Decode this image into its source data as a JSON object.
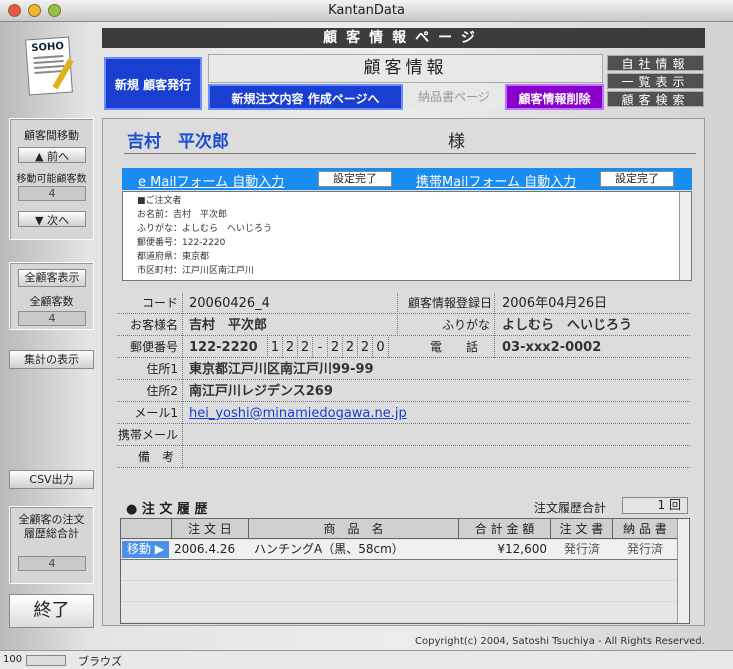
{
  "window": {
    "title": "KantanData"
  },
  "header": {
    "page_title": "顧客情報ページ"
  },
  "nav": {
    "new_customer": "新規 顧客発行",
    "new_order_page": "新規注文内容 作成ページへ",
    "delivery_page": "納品書ページ",
    "delete_customer": "顧客情報削除",
    "company_info": "自社情報",
    "list_view": "一覧表示",
    "customer_search": "顧客検索"
  },
  "section": {
    "title": "顧客情報"
  },
  "left": {
    "logo_text": "SOHO",
    "move_label": "顧客間移動",
    "prev": "▲ 前へ",
    "movable_label": "移動可能顧客数",
    "movable_count": "4",
    "next": "▼ 次へ",
    "show_all": "全顧客表示",
    "total_label": "全顧客数",
    "total_count": "4",
    "summary": "集計の表示",
    "csv": "CSV出力",
    "total_orders_label": "全顧客の注文履歴総合計",
    "total_orders": "4",
    "quit": "終了"
  },
  "customer": {
    "name": "吉村　平次郎",
    "honorific": "様"
  },
  "mail": {
    "email_form": "e Mailフォーム 自動入力",
    "email_done": "設定完了",
    "mobile_form": "携帯Mailフォーム 自動入力",
    "mobile_done": "設定完了",
    "preview_lines": [
      "■ご注文者",
      "お名前：吉村　平次郎",
      "ふりがな：よしむら　へいじろう",
      "郵便番号：122-2220",
      "都道府県：東京都",
      "市区町村：江戸川区南江戸川"
    ]
  },
  "fields": {
    "code_label": "コード",
    "code": "20060426_4",
    "reg_label": "顧客情報登録日",
    "reg_date": "2006年04月26日",
    "name_label": "お客様名",
    "name": "吉村　平次郎",
    "kana_label": "ふりがな",
    "kana": "よしむら　へいじろう",
    "zip_label": "郵便番号",
    "zip": "122-2220",
    "zip_digits": [
      "1",
      "2",
      "2",
      "-",
      "2",
      "2",
      "2",
      "0"
    ],
    "tel_label": "電　　話",
    "tel": "03-xxx2-0002",
    "addr1_label": "住所1",
    "addr1": "東京都江戸川区南江戸川99-99",
    "addr2_label": "住所2",
    "addr2": "南江戸川レジデンス269",
    "mail_label": "メール1",
    "mail": "hei_yoshi@minamiedogawa.ne.jp",
    "mobile_label": "携帯メール",
    "mobile": "",
    "note_label": "備　考",
    "note": ""
  },
  "orders": {
    "title": "● 注 文 履 歴",
    "total_label": "注文履歴合計",
    "total": "1 回",
    "headers": [
      "注 文 日",
      "商　品　名",
      "合 計 金 額",
      "注 文 書",
      "納 品 書"
    ],
    "rows": [
      {
        "move": "移動 ▶",
        "date": "2006.4.26",
        "product": "ハンチングA（黒、58cm）",
        "amount": "¥12,600",
        "order_doc": "発行済",
        "delivery_doc": "発行済"
      }
    ]
  },
  "footer": {
    "copyright": "Copyright(c) 2004, Satoshi Tsuchiya - All Rights Reserved."
  },
  "status": {
    "zoom": "100",
    "mode": "ブラウズ"
  }
}
